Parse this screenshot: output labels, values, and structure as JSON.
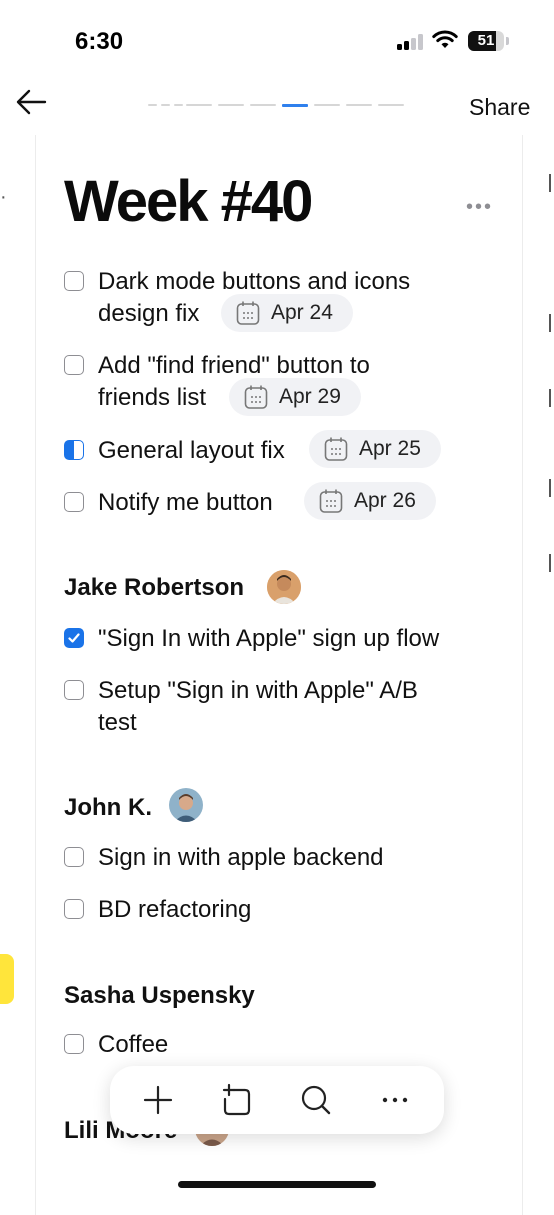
{
  "status_bar": {
    "time": "6:30",
    "battery": "51",
    "icons": [
      "signal-icon",
      "wifi-icon",
      "battery-icon"
    ]
  },
  "nav": {
    "back_icon": "arrow-left-icon",
    "share_label": "Share",
    "pager": {
      "pages": 8,
      "active_index": 4
    }
  },
  "page": {
    "title": "Week #40",
    "more_icon": "ellipsis-icon"
  },
  "tasks": [
    {
      "lines": [
        "Dark mode buttons and icons",
        "design fix"
      ],
      "date": "Apr 24",
      "state": "unchecked"
    },
    {
      "lines": [
        "Add \"find friend\" button to",
        "friends list"
      ],
      "date": "Apr 29",
      "state": "unchecked"
    },
    {
      "lines": [
        "General layout fix"
      ],
      "date": "Apr 25",
      "state": "in-progress"
    },
    {
      "lines": [
        "Notify me button"
      ],
      "date": "Apr 26",
      "state": "unchecked"
    }
  ],
  "sections": [
    {
      "name": "Jake Robertson",
      "tasks": [
        {
          "lines": [
            "\"Sign In with Apple\" sign up flow"
          ],
          "state": "checked"
        },
        {
          "lines": [
            "Setup \"Sign in with Apple\" A/B",
            "test"
          ],
          "state": "unchecked"
        }
      ]
    },
    {
      "name": "John K.",
      "tasks": [
        {
          "lines": [
            "Sign in with apple backend"
          ],
          "state": "unchecked"
        },
        {
          "lines": [
            "BD refactoring"
          ],
          "state": "unchecked"
        }
      ]
    },
    {
      "name": "Sasha Uspensky",
      "tasks": [
        {
          "lines": [
            "Coffee"
          ],
          "state": "unchecked"
        }
      ]
    },
    {
      "name": "Lili Moore",
      "tasks": []
    }
  ],
  "toolbar": {
    "items": [
      "plus-icon",
      "add-card-icon",
      "search-icon",
      "ellipsis-icon"
    ]
  },
  "colors": {
    "accent": "#1a73e8",
    "chip_bg": "#f1f2f5",
    "highlight": "#ffe53b"
  }
}
